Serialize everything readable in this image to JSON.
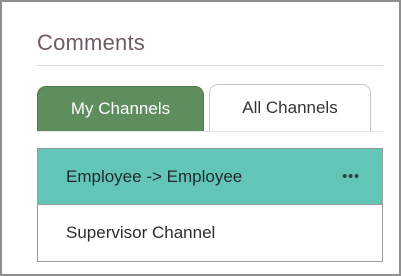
{
  "panel": {
    "title": "Comments"
  },
  "tabs": [
    {
      "label": "My Channels",
      "active": true
    },
    {
      "label": "All Channels",
      "active": false
    }
  ],
  "channels": [
    {
      "label": "Employee -> Employee",
      "selected": true,
      "menu_icon": "more-dots-icon",
      "menu_glyph": "•••"
    },
    {
      "label": "Supervisor Channel",
      "selected": false
    }
  ],
  "colors": {
    "title": "#6f5b66",
    "active_tab": "#5e8d5e",
    "selected_row": "#62c5b8"
  }
}
